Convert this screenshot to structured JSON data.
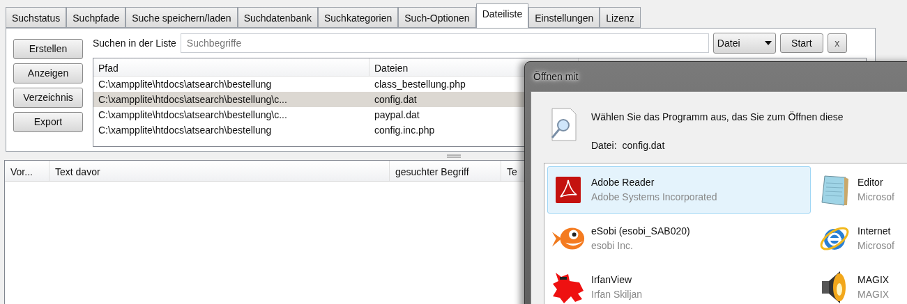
{
  "tabs": [
    {
      "label": "Suchstatus",
      "selected": false
    },
    {
      "label": "Suchpfade",
      "selected": false
    },
    {
      "label": "Suche speichern/laden",
      "selected": false
    },
    {
      "label": "Suchdatenbank",
      "selected": false
    },
    {
      "label": "Suchkategorien",
      "selected": false
    },
    {
      "label": "Such-Optionen",
      "selected": false
    },
    {
      "label": "Dateiliste",
      "selected": true
    },
    {
      "label": "Einstellungen",
      "selected": false
    },
    {
      "label": "Lizenz",
      "selected": false
    }
  ],
  "side_buttons": [
    "Erstellen",
    "Anzeigen",
    "Verzeichnis",
    "Export"
  ],
  "search": {
    "label": "Suchen in der Liste",
    "placeholder": "Suchbegriffe",
    "scope": "Datei",
    "start": "Start",
    "clear": "x"
  },
  "file_table": {
    "columns": [
      "Pfad",
      "Dateien"
    ],
    "rows": [
      {
        "cells": [
          "C:\\xampplite\\htdocs\\atsearch\\bestellung",
          "class_bestellung.php"
        ],
        "selected": false
      },
      {
        "cells": [
          "C:\\xampplite\\htdocs\\atsearch\\bestellung\\c...",
          "config.dat"
        ],
        "selected": true
      },
      {
        "cells": [
          "C:\\xampplite\\htdocs\\atsearch\\bestellung\\c...",
          "paypal.dat"
        ],
        "selected": false
      },
      {
        "cells": [
          "C:\\xampplite\\htdocs\\atsearch\\bestellung",
          "config.inc.php"
        ],
        "selected": false
      }
    ]
  },
  "results_table": {
    "columns": [
      "Vor...",
      "Text davor",
      "gesuchter Begriff",
      "Te"
    ]
  },
  "dialog": {
    "title": "Öffnen mit",
    "instruction": "Wählen Sie das Programm aus, das Sie zum Öffnen diese",
    "file_label": "Datei:",
    "file_name": "config.dat",
    "programs": [
      {
        "name": "Adobe Reader",
        "publisher": "Adobe Systems Incorporated",
        "selected": true
      },
      {
        "name": "Editor",
        "publisher": "Microsof",
        "selected": false
      },
      {
        "name": "eSobi (esobi_SAB020)",
        "publisher": "esobi Inc.",
        "selected": false
      },
      {
        "name": "Internet",
        "publisher": "Microsof",
        "selected": false
      },
      {
        "name": "IrfanView",
        "publisher": "Irfan Skiljan",
        "selected": false
      },
      {
        "name": "MAGIX",
        "publisher": "MAGIX",
        "selected": false
      }
    ]
  }
}
